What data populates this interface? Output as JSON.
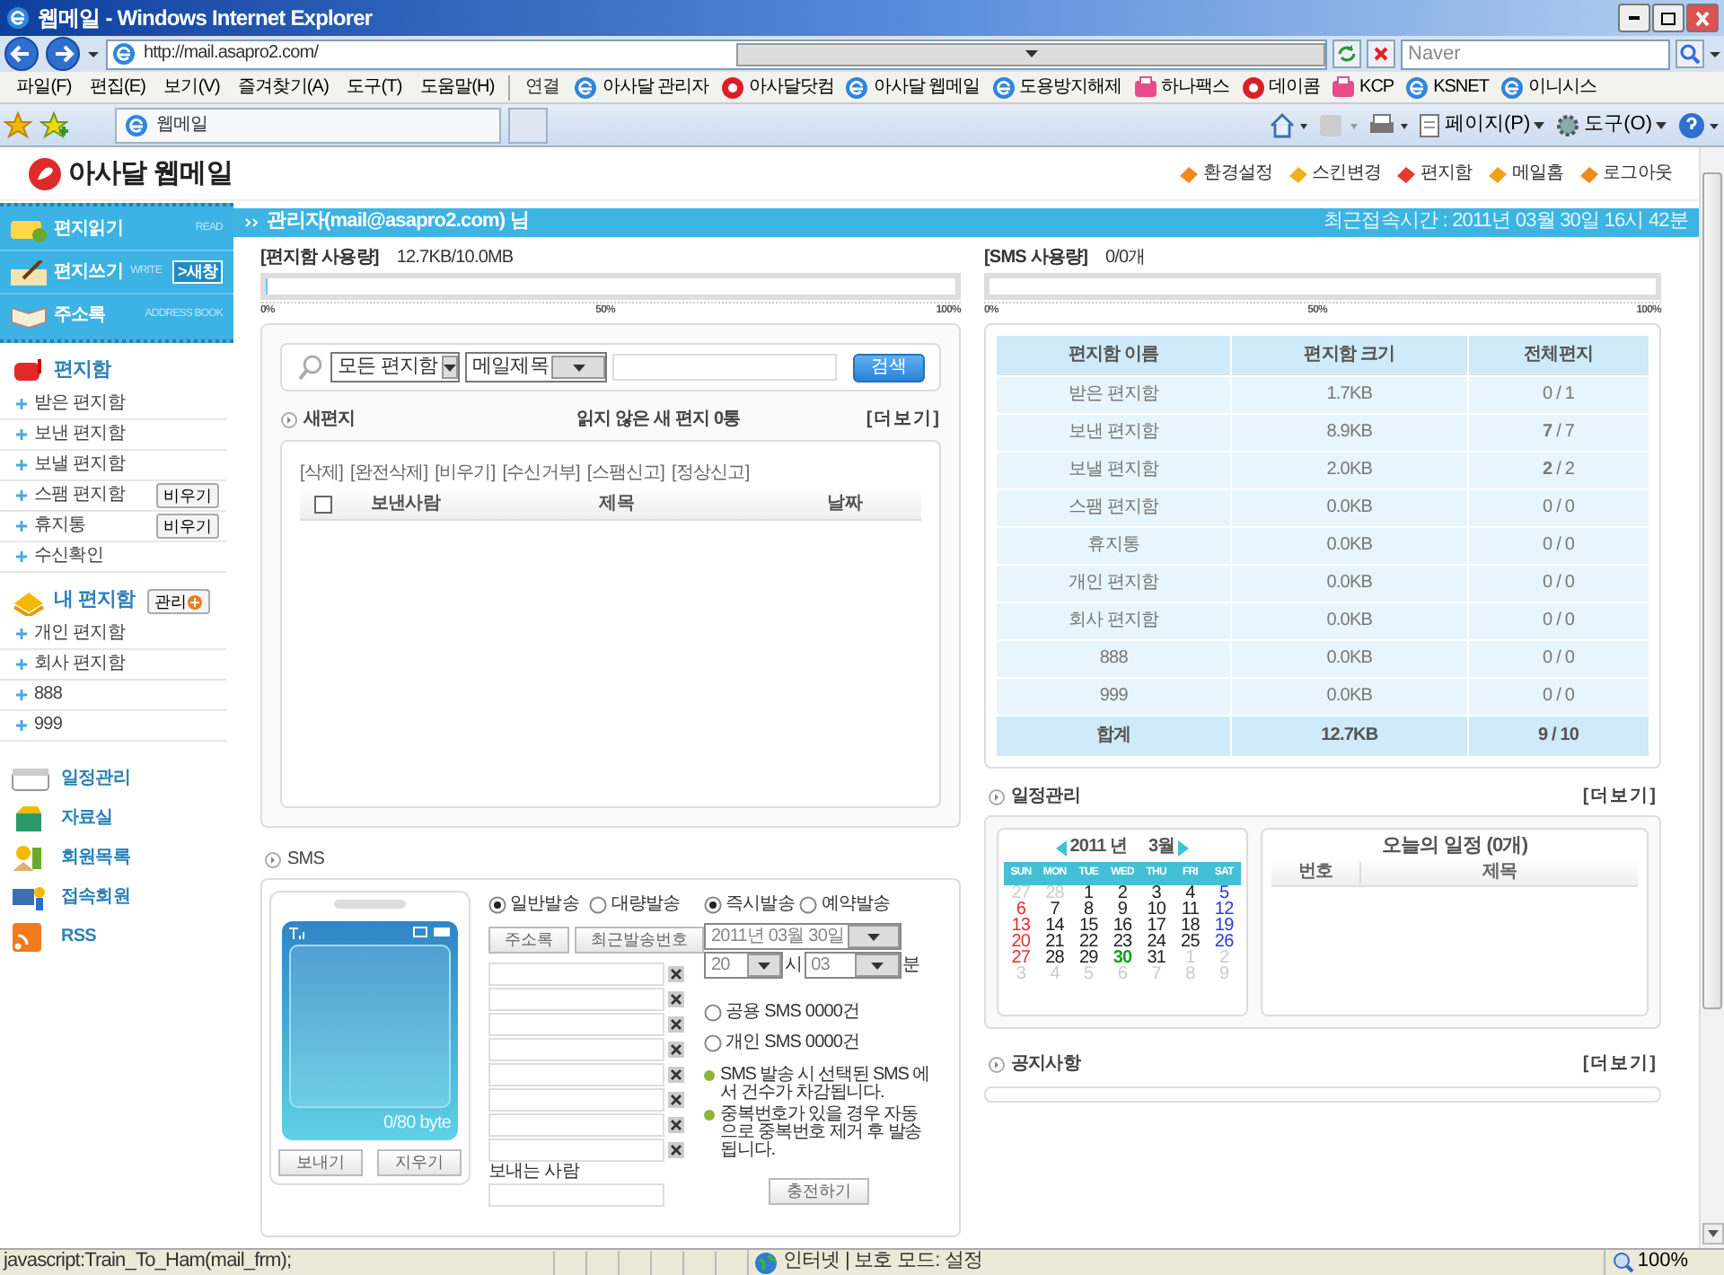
{
  "window": {
    "title": "웹메일 - Windows Internet Explorer"
  },
  "address_bar": {
    "url": "http://mail.asapro2.com/",
    "search_placeholder": "Naver"
  },
  "menu": [
    "파일(F)",
    "편집(E)",
    "보기(V)",
    "즐겨찾기(A)",
    "도구(T)",
    "도움말(H)"
  ],
  "links": {
    "label": "연결",
    "items": [
      {
        "label": "아사달 관리자",
        "kind": "page"
      },
      {
        "label": "아사달닷컴",
        "kind": "logo"
      },
      {
        "label": "아사달 웹메일",
        "kind": "page"
      },
      {
        "label": "도용방지해제",
        "kind": "page"
      },
      {
        "label": "하나팩스",
        "kind": "fax"
      },
      {
        "label": "데이콤",
        "kind": "logo"
      },
      {
        "label": "KCP",
        "kind": "fax"
      },
      {
        "label": "KSNET",
        "kind": "page"
      },
      {
        "label": "이니시스",
        "kind": "page"
      }
    ]
  },
  "tab": {
    "title": "웹메일"
  },
  "command_bar": [
    "페이지(P)",
    "도구(O)"
  ],
  "header": {
    "logo": "아사달 웹메일",
    "links": [
      "환경설정",
      "스킨변경",
      "편지함",
      "메일홈",
      "로그아웃"
    ]
  },
  "sidebar": {
    "main_buttons": [
      {
        "label": "편지읽기",
        "sub": "READ"
      },
      {
        "label": "편지쓰기",
        "sub": "WRITE",
        "badge": ">새창"
      },
      {
        "label": "주소록",
        "sub": "ADDRESS BOOK"
      }
    ],
    "mailbox_title": "편지함",
    "mailboxes": [
      {
        "label": "받은 편지함"
      },
      {
        "label": "보낸 편지함"
      },
      {
        "label": "보낼 편지함"
      },
      {
        "label": "스팸 편지함",
        "action": "비우기"
      },
      {
        "label": "휴지통",
        "action": "비우기"
      },
      {
        "label": "수신확인"
      }
    ],
    "my_title": "내 편지함",
    "my_action": "관리",
    "my_mailboxes": [
      {
        "label": "개인 편지함"
      },
      {
        "label": "회사 편지함"
      },
      {
        "label": "888"
      },
      {
        "label": "999"
      }
    ],
    "tools": [
      "일정관리",
      "자료실",
      "회원목록",
      "접속회원",
      "RSS"
    ]
  },
  "user_bar": {
    "user": "관리자(mail@asapro2.com) 님",
    "last_login": "최근접속시간 : 2011년 03월 30일 16시 42분"
  },
  "mailbox_usage": {
    "label": "[편지함 사용량]",
    "value": "12.7KB/10.0MB",
    "level": 0.002,
    "ticks": [
      "0%",
      "50%",
      "100%"
    ]
  },
  "search": {
    "folder": "모든 편지함",
    "field": "메일제목",
    "button": "검색"
  },
  "new_mail": {
    "select_all": {
      "checked": false
    },
    "title": "새편지",
    "summary": "읽지 않은 새 편지 0통",
    "more": "[더보기]",
    "actions": [
      "[삭제]",
      "[완전삭제]",
      "[비우기]",
      "[수신거부]",
      "[스팸신고]",
      "[정상신고]"
    ],
    "columns": [
      "보낸사람",
      "제목",
      "날짜"
    ]
  },
  "sms": {
    "title": "SMS",
    "counter": "0/80 byte",
    "buttons": [
      "보내기",
      "지우기"
    ],
    "send_modes": [
      {
        "label": "일반발송",
        "selected": true
      },
      {
        "label": "대량발송",
        "selected": false
      }
    ],
    "lookup_buttons": [
      "주소록",
      "최근발송번호"
    ],
    "recipient_fields": [
      {
        "kind": "field"
      },
      {
        "kind": "field"
      },
      {
        "kind": "field"
      },
      {
        "kind": "field"
      },
      {
        "kind": "field"
      },
      {
        "kind": "field"
      },
      {
        "kind": "field"
      },
      {
        "kind": "field"
      }
    ],
    "sender_label": "보내는 사람",
    "timing": [
      {
        "label": "즉시발송",
        "selected": true
      },
      {
        "label": "예약발송",
        "selected": false
      }
    ],
    "date": "2011년 03월 30일",
    "hour": "20",
    "hour_unit": "시",
    "minute": "03",
    "minute_unit": "분",
    "pools": [
      {
        "label": "공용 SMS 0000건",
        "selected": false
      },
      {
        "label": "개인 SMS 0000건",
        "selected": false
      }
    ],
    "notes": [
      "SMS 발송 시 선택된 SMS 에서 건수가 차감됩니다.",
      "중복번호가 있을 경우 자동으로 중복번호 제거 후 발송됩니다."
    ],
    "charge_button": "충전하기"
  },
  "sms_usage": {
    "label": "[SMS 사용량]",
    "value": "0/0개",
    "level": 0,
    "ticks": [
      "0%",
      "50%",
      "100%"
    ]
  },
  "folder_table": {
    "columns": [
      "편지함 이름",
      "편지함 크기",
      "전체편지"
    ],
    "rows": [
      {
        "name": "받은 편지함",
        "size": "1.7KB",
        "total": "0 / 1"
      },
      {
        "name": "보낸 편지함",
        "size": "8.9KB",
        "total": "**7** / 7"
      },
      {
        "name": "보낼 편지함",
        "size": "2.0KB",
        "total": "**2** / 2"
      },
      {
        "name": "스팸 편지함",
        "size": "0.0KB",
        "total": "0 / 0"
      },
      {
        "name": "휴지통",
        "size": "0.0KB",
        "total": "0 / 0"
      },
      {
        "name": "개인 편지함",
        "size": "0.0KB",
        "total": "0 / 0"
      },
      {
        "name": "회사 편지함",
        "size": "0.0KB",
        "total": "0 / 0"
      },
      {
        "name": "888",
        "size": "0.0KB",
        "total": "0 / 0"
      },
      {
        "name": "999",
        "size": "0.0KB",
        "total": "0 / 0"
      }
    ],
    "footer": {
      "name": "합계",
      "size": "12.7KB",
      "total": "9 / 10"
    }
  },
  "schedule": {
    "title": "일정관리",
    "more": "[더보기]",
    "calendar": {
      "year": "2011",
      "year_unit": "년",
      "month": "3월",
      "weekdays": [
        "SUN",
        "MON",
        "TUE",
        "WED",
        "THU",
        "FRI",
        "SAT"
      ],
      "days": [
        {
          "text": "27",
          "kind": "other"
        },
        {
          "text": "28",
          "kind": "other"
        },
        {
          "text": "1",
          "kind": "day"
        },
        {
          "text": "2",
          "kind": "day"
        },
        {
          "text": "3",
          "kind": "day"
        },
        {
          "text": "4",
          "kind": "day"
        },
        {
          "text": "5",
          "kind": "sat"
        },
        {
          "text": "6",
          "kind": "sun"
        },
        {
          "text": "7",
          "kind": "day"
        },
        {
          "text": "8",
          "kind": "day"
        },
        {
          "text": "9",
          "kind": "day"
        },
        {
          "text": "10",
          "kind": "day"
        },
        {
          "text": "11",
          "kind": "day"
        },
        {
          "text": "12",
          "kind": "sat"
        },
        {
          "text": "13",
          "kind": "sun"
        },
        {
          "text": "14",
          "kind": "day"
        },
        {
          "text": "15",
          "kind": "day"
        },
        {
          "text": "16",
          "kind": "day"
        },
        {
          "text": "17",
          "kind": "day"
        },
        {
          "text": "18",
          "kind": "day"
        },
        {
          "text": "19",
          "kind": "sat"
        },
        {
          "text": "20",
          "kind": "sun"
        },
        {
          "text": "21",
          "kind": "day"
        },
        {
          "text": "22",
          "kind": "day"
        },
        {
          "text": "23",
          "kind": "day"
        },
        {
          "text": "24",
          "kind": "day"
        },
        {
          "text": "25",
          "kind": "day"
        },
        {
          "text": "26",
          "kind": "sat"
        },
        {
          "text": "27",
          "kind": "sun"
        },
        {
          "text": "28",
          "kind": "day"
        },
        {
          "text": "29",
          "kind": "day"
        },
        {
          "text": "30",
          "kind": "today"
        },
        {
          "text": "31",
          "kind": "day"
        },
        {
          "text": "1",
          "kind": "other"
        },
        {
          "text": "2",
          "kind": "other"
        },
        {
          "text": "3",
          "kind": "other"
        },
        {
          "text": "4",
          "kind": "other"
        },
        {
          "text": "5",
          "kind": "other"
        },
        {
          "text": "6",
          "kind": "other"
        },
        {
          "text": "7",
          "kind": "other"
        },
        {
          "text": "8",
          "kind": "other"
        },
        {
          "text": "9",
          "kind": "other"
        }
      ]
    },
    "today_title": "오늘의 일정 (0개)",
    "today_columns": [
      "번호",
      "제목"
    ]
  },
  "notice": {
    "title": "공지사항",
    "more": "[더보기]"
  },
  "status_bar": {
    "text": "javascript:Train_To_Ham(mail_frm);",
    "zone": "인터넷 | 보호 모드: 설정",
    "zoom": "100%"
  }
}
